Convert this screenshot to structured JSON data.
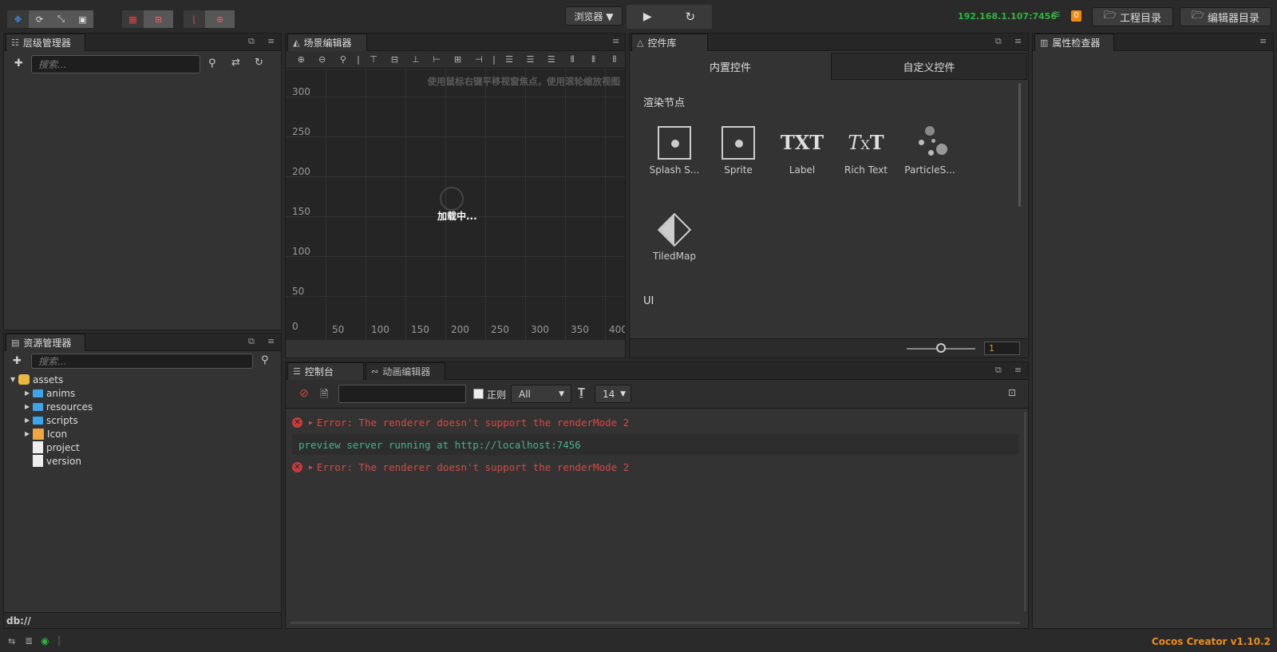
{
  "toolbar": {
    "left_tools": [
      "move",
      "rotate",
      "scale",
      "rect"
    ],
    "browser_dropdown": "浏览器 ▼",
    "ip": "192.168.1.107:7456",
    "notif_count": "0",
    "project_dir": "工程目录",
    "editor_dir": "编辑器目录"
  },
  "hierarchy": {
    "title": "层级管理器",
    "search_placeholder": "搜索..."
  },
  "assets": {
    "title": "资源管理器",
    "search_placeholder": "搜索...",
    "root": "assets",
    "items": [
      "anims",
      "resources",
      "scripts",
      "Icon",
      "project",
      "version"
    ],
    "footer": "db://"
  },
  "scene": {
    "title": "场景编辑器",
    "hint": "使用鼠标右键平移视窗焦点，使用滚轮缩放视图",
    "loading": "加载中...",
    "y_ticks": [
      "300",
      "250",
      "200",
      "150",
      "100",
      "50",
      "0"
    ],
    "x_ticks": [
      "50",
      "100",
      "150",
      "200",
      "250",
      "300",
      "350",
      "400"
    ]
  },
  "widgets": {
    "title": "控件库",
    "tab_builtin": "内置控件",
    "tab_custom": "自定义控件",
    "section_render": "渲染节点",
    "section_ui": "UI",
    "items": [
      "Splash S...",
      "Sprite",
      "Label",
      "Rich Text",
      "ParticleS...",
      "TiledMap"
    ],
    "txt_label": "TXT",
    "zoom_value": "1"
  },
  "inspector": {
    "title": "属性检查器"
  },
  "console": {
    "title": "控制台",
    "anim_title": "动画编辑器",
    "regex_label": "正则",
    "filter_level": "All",
    "font_size": "14",
    "lines": [
      {
        "type": "error",
        "text": "Error: The renderer doesn't support the renderMode 2"
      },
      {
        "type": "info",
        "text": "preview server running at http://localhost:7456"
      },
      {
        "type": "error",
        "text": "Error: The renderer doesn't support the renderMode 2"
      }
    ]
  },
  "status": {
    "version": "Cocos Creator v1.10.2"
  },
  "colors": {
    "accent_orange": "#f08c14",
    "ip_green": "#2fb43c",
    "error_red": "#d44a48",
    "info_green": "#49b08e"
  }
}
